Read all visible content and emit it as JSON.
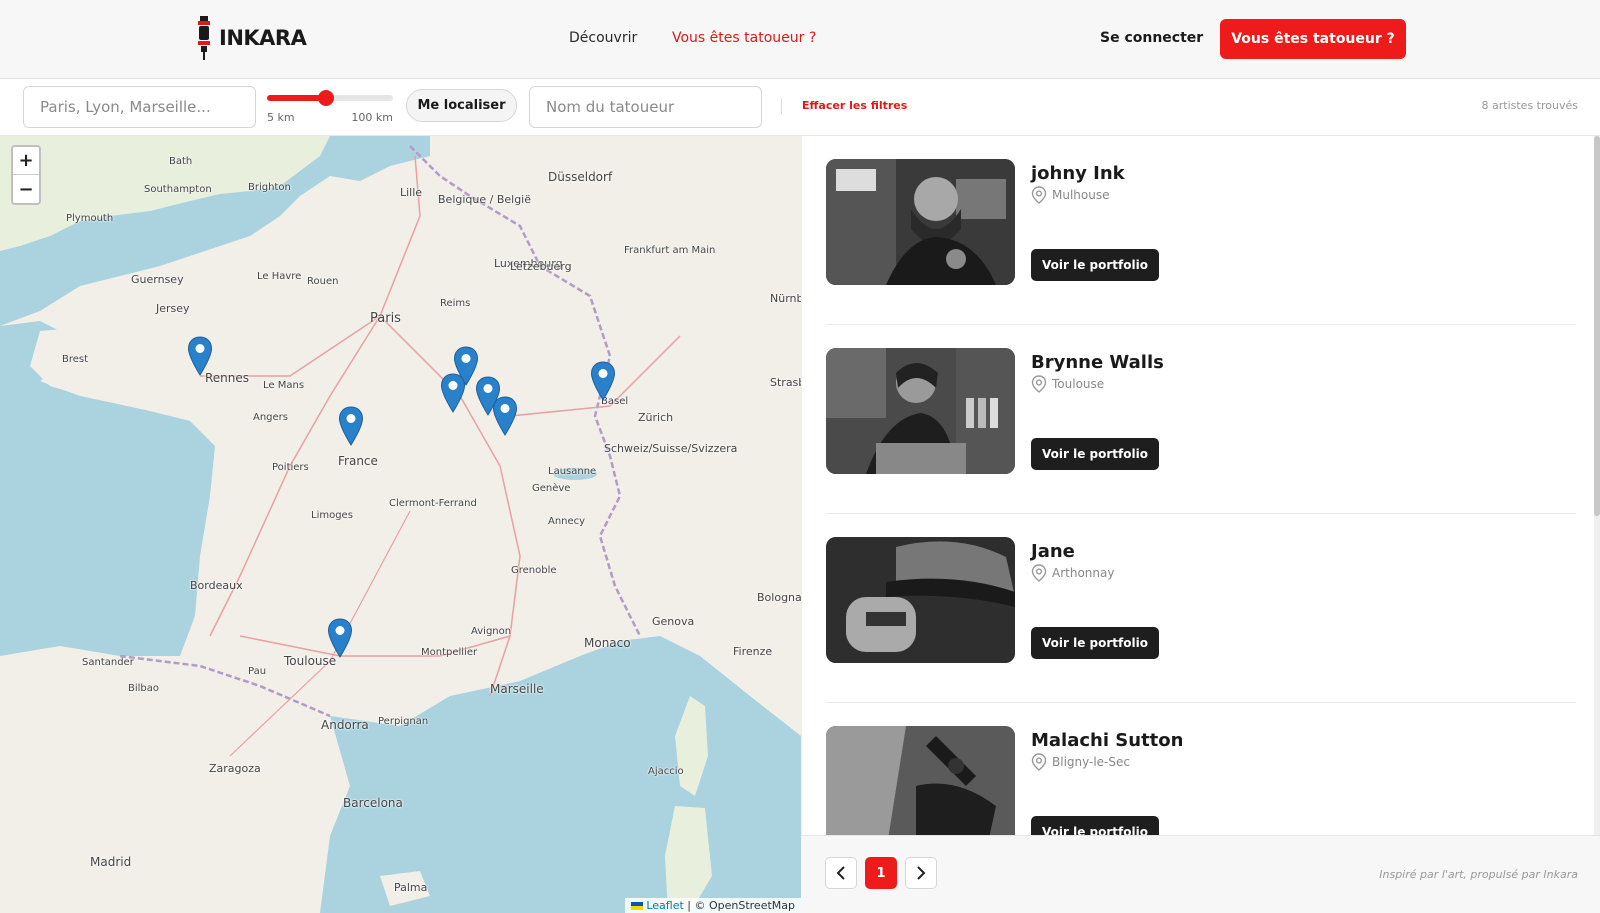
{
  "header": {
    "logo_text": "INKARA",
    "nav_discover": "Découvrir",
    "nav_tattooist": "Vous êtes tatoueur ?",
    "login": "Se connecter",
    "cta": "Vous êtes tatoueur ?"
  },
  "filters": {
    "city_placeholder": "Paris, Lyon, Marseille...",
    "range_min": "5 km",
    "range_max": "100 km",
    "range_fraction": 0.47,
    "locate_label": "Me localiser",
    "name_placeholder": "Nom du tatoueur",
    "clear_label": "Effacer les filtres",
    "count": "8 artistes trouvés"
  },
  "map": {
    "zoom_in": "+",
    "zoom_out": "−",
    "attribution_leaflet": "Leaflet",
    "attribution_osm": "| © OpenStreetMap",
    "labels": [
      {
        "text": "Paris"
      },
      {
        "text": "Rennes"
      },
      {
        "text": "Brest"
      },
      {
        "text": "Le Mans"
      },
      {
        "text": "Angers"
      },
      {
        "text": "France"
      },
      {
        "text": "Poitiers"
      },
      {
        "text": "Limoges"
      },
      {
        "text": "Bordeaux"
      },
      {
        "text": "Toulouse"
      },
      {
        "text": "Montpellier"
      },
      {
        "text": "Marseille"
      },
      {
        "text": "Clermont-Ferrand"
      },
      {
        "text": "Lille"
      },
      {
        "text": "Reims"
      },
      {
        "text": "Basel"
      },
      {
        "text": "Zürich"
      },
      {
        "text": "Genève"
      },
      {
        "text": "Lausanne"
      },
      {
        "text": "Annecy"
      },
      {
        "text": "Grenoble"
      },
      {
        "text": "Avignon"
      },
      {
        "text": "Monaco"
      },
      {
        "text": "Genova"
      },
      {
        "text": "Barcelona"
      },
      {
        "text": "Andorra"
      },
      {
        "text": "Zaragoza"
      },
      {
        "text": "Madrid"
      },
      {
        "text": "Bilbao"
      },
      {
        "text": "Luxembourg"
      },
      {
        "text": "Letzebuerg"
      },
      {
        "text": "Frankfurt am Main"
      },
      {
        "text": "Düsseldorf"
      },
      {
        "text": "Belgique / België"
      },
      {
        "text": "Nürnberg"
      },
      {
        "text": "Schweiz/Suisse/Svizzera"
      },
      {
        "text": "Brighton"
      },
      {
        "text": "Southampton"
      },
      {
        "text": "Bath"
      },
      {
        "text": "Plymouth"
      },
      {
        "text": "Guernsey"
      },
      {
        "text": "Jersey"
      },
      {
        "text": "Le Havre"
      },
      {
        "text": "Rouen"
      },
      {
        "text": "Perpignan"
      },
      {
        "text": "Ajaccio"
      },
      {
        "text": "Firenze"
      },
      {
        "text": "Bologna"
      },
      {
        "text": "Palma"
      },
      {
        "text": "Santander"
      },
      {
        "text": "Pau"
      },
      {
        "text": "Strasbourg"
      }
    ]
  },
  "artists": [
    {
      "name": "johny Ink",
      "city": "Mulhouse",
      "button": "Voir le portfolio"
    },
    {
      "name": "Brynne Walls",
      "city": "Toulouse",
      "button": "Voir le portfolio"
    },
    {
      "name": "Jane",
      "city": "Arthonnay",
      "button": "Voir le portfolio"
    },
    {
      "name": "Malachi Sutton",
      "city": "Bligny-le-Sec",
      "button": "Voir le portfolio"
    }
  ],
  "pager": {
    "prev": "‹",
    "current": "1",
    "next": "›",
    "tagline": "Inspiré par l'art, propulsé par Inkara"
  },
  "colors": {
    "accent": "#ef1a1a",
    "dark": "#1e1e1e",
    "marker": "#2a81cb",
    "sea": "#aad3df",
    "land": "#f2efe9"
  }
}
